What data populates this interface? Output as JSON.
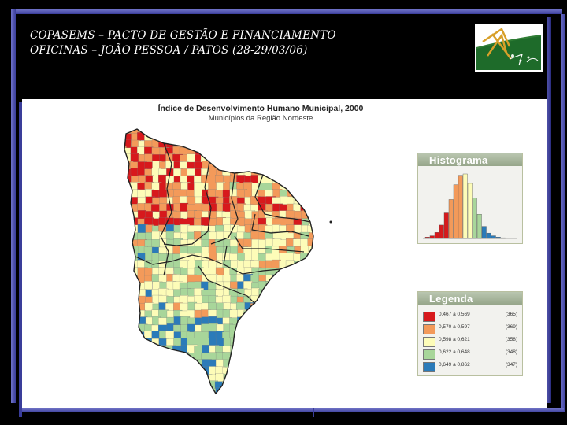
{
  "header": {
    "line1": "COPASEMS – PACTO DE GESTÃO E FINANCIAMENTO",
    "line2": "OFICINAS – JOÃO PESSOA / PATOS (28-29/03/06)"
  },
  "map": {
    "title": "Índice de Desenvolvimento Humano Municipal, 2000",
    "subtitle": "Municípios da Região Nordeste"
  },
  "histogram": {
    "heading": "Histograma",
    "bins": [
      2,
      4,
      9,
      20,
      38,
      58,
      80,
      94,
      96,
      82,
      60,
      36,
      18,
      8,
      4,
      2,
      1
    ],
    "bin_class": [
      0,
      0,
      0,
      0,
      0,
      1,
      1,
      1,
      2,
      2,
      3,
      3,
      4,
      4,
      4,
      4,
      4
    ]
  },
  "legend": {
    "heading": "Legenda",
    "items": [
      {
        "label": "0,467 a 0,569",
        "count": "(365)",
        "color": "#d7191c"
      },
      {
        "label": "0,570 a 0,597",
        "count": "(369)",
        "color": "#f39a5a"
      },
      {
        "label": "0,598 a 0,621",
        "count": "(358)",
        "color": "#fdfcb8"
      },
      {
        "label": "0,622 a 0,648",
        "count": "(348)",
        "color": "#a8d69a"
      },
      {
        "label": "0,649 a 0,862",
        "count": "(347)",
        "color": "#2b7bb9"
      }
    ]
  }
}
